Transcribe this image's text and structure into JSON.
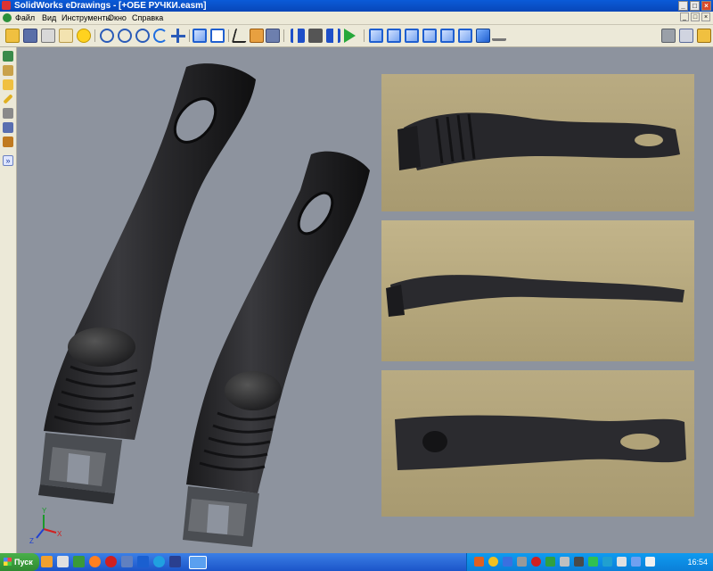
{
  "window": {
    "title": "SolidWorks eDrawings - [+ОБЕ РУЧКИ.easm]",
    "controls": [
      "_",
      "□",
      "×"
    ]
  },
  "menu": {
    "items": [
      "Файл",
      "Вид",
      "Инструменты",
      "Окно",
      "Справка"
    ],
    "mdi_controls": [
      "_",
      "□",
      "×"
    ]
  },
  "toolbar": {
    "icons": [
      "open-icon",
      "save-icon",
      "print-icon",
      "email-icon",
      "help-icon",
      "zoom-to-fit-icon",
      "zoom-area-icon",
      "zoom-icon",
      "rotate-icon",
      "pan-icon",
      "shaded-icon",
      "wireframe-icon",
      "select-icon",
      "home-icon",
      "measure-icon",
      "first-frame-icon",
      "stop-icon",
      "next-frame-icon",
      "play-icon",
      "view-front-icon",
      "view-back-icon",
      "view-left-icon",
      "view-right-icon",
      "view-top-icon",
      "view-iso-icon",
      "section-icon",
      "markup-icon",
      "stamp-icon",
      "lock-icon"
    ]
  },
  "left_panel": {
    "icons": [
      "components-icon",
      "configurations-icon",
      "sheets-icon",
      "markup-pen-icon",
      "measure-panel-icon",
      "properties-icon",
      "stamp-panel-icon",
      "expand-icon"
    ],
    "expand_label": "»"
  },
  "viewport": {
    "triad": {
      "x": "X",
      "y": "Y",
      "z": "Z"
    }
  },
  "taskbar": {
    "start_label": "Пуск",
    "language": "EN",
    "clock": "16:54"
  }
}
